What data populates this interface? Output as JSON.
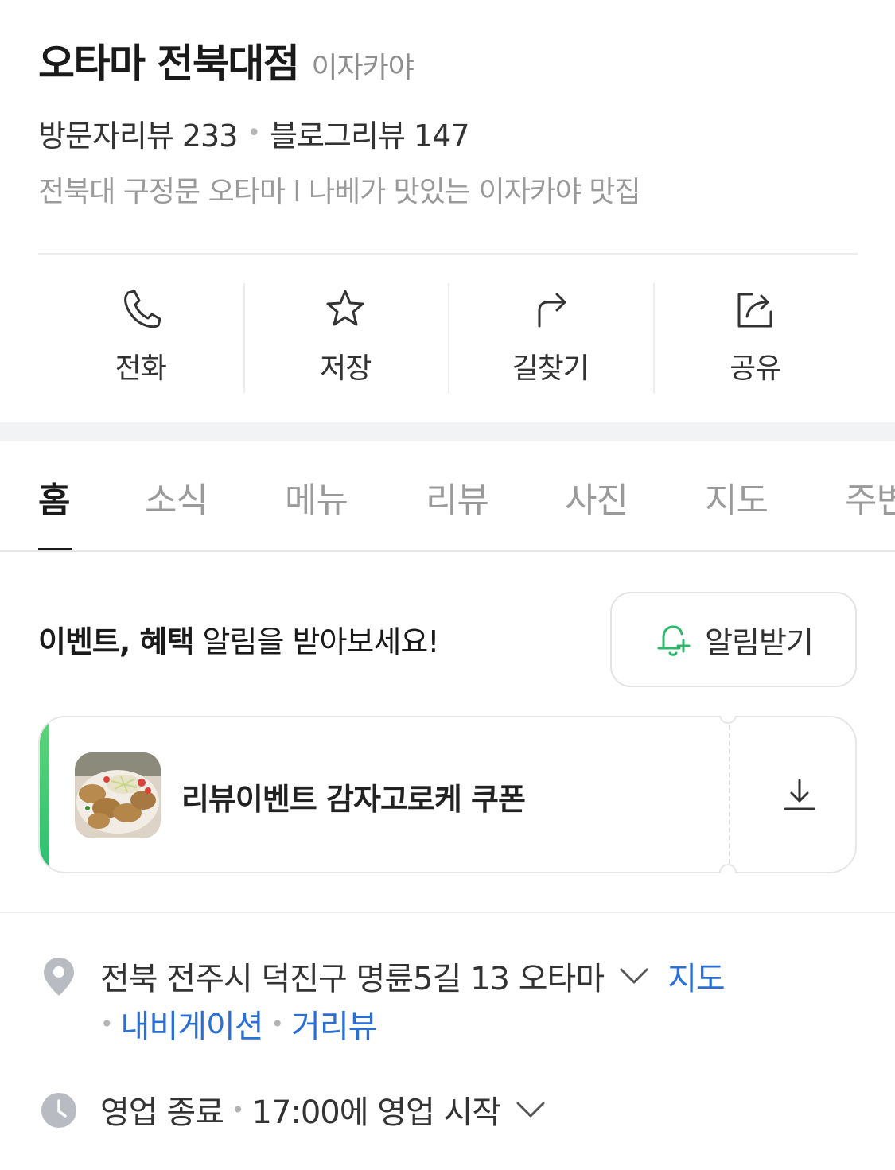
{
  "header": {
    "store_name": "오타마 전북대점",
    "category": "이자카야",
    "visitor_reviews": "방문자리뷰 233",
    "blog_reviews": "블로그리뷰 147",
    "description": "전북대 구정문 오타마 l 나베가 맛있는 이자카야 맛집"
  },
  "actions": [
    {
      "label": "전화",
      "icon": "phone-icon"
    },
    {
      "label": "저장",
      "icon": "star-icon"
    },
    {
      "label": "길찾기",
      "icon": "directions-icon"
    },
    {
      "label": "공유",
      "icon": "share-icon"
    }
  ],
  "tabs": [
    {
      "label": "홈",
      "active": true
    },
    {
      "label": "소식"
    },
    {
      "label": "메뉴"
    },
    {
      "label": "리뷰"
    },
    {
      "label": "사진"
    },
    {
      "label": "지도"
    },
    {
      "label": "주변"
    }
  ],
  "notify": {
    "bold_text": "이벤트, 혜택",
    "text": " 알림을 받아보세요!",
    "button_label": "알림받기",
    "icon": "bell-plus-icon"
  },
  "coupon": {
    "title": "리뷰이벤트 감자고로케 쿠폰",
    "thumbnail": "croquette-photo",
    "action_icon": "download-icon",
    "accent_color": "#3ec873"
  },
  "address": {
    "text": "전북 전주시 덕진구 명륜5길 13 오타마",
    "map_link": "지도",
    "nav_link": "내비게이션",
    "street_link": "거리뷰",
    "icon": "location-pin-icon"
  },
  "hours": {
    "status": "영업 종료",
    "next": "17:00에 영업 시작",
    "icon": "clock-icon"
  },
  "colors": {
    "link": "#2a6fd6",
    "accent_green": "#3ec873",
    "text_primary": "#1a1a1a",
    "text_muted": "#9a9a9a"
  }
}
